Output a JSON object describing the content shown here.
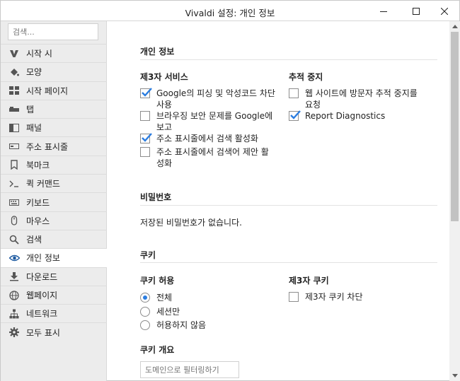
{
  "window": {
    "title": "Vivaldi 설정: 개인 정보"
  },
  "sidebar": {
    "search_placeholder": "검색...",
    "items": [
      {
        "label": "시작 시",
        "icon": "vivaldi-logo-icon"
      },
      {
        "label": "모양",
        "icon": "paint-bucket-icon"
      },
      {
        "label": "시작 페이지",
        "icon": "speed-dial-grid-icon"
      },
      {
        "label": "탭",
        "icon": "tabs-icon"
      },
      {
        "label": "패널",
        "icon": "panel-icon"
      },
      {
        "label": "주소 표시줄",
        "icon": "address-bar-icon"
      },
      {
        "label": "북마크",
        "icon": "bookmark-icon"
      },
      {
        "label": "퀵 커맨드",
        "icon": "quick-command-icon"
      },
      {
        "label": "키보드",
        "icon": "keyboard-icon"
      },
      {
        "label": "마우스",
        "icon": "mouse-icon"
      },
      {
        "label": "검색",
        "icon": "search-icon"
      },
      {
        "label": "개인 정보",
        "icon": "eye-icon",
        "active": true
      },
      {
        "label": "다운로드",
        "icon": "download-icon"
      },
      {
        "label": "웹페이지",
        "icon": "globe-icon"
      },
      {
        "label": "네트워크",
        "icon": "network-icon"
      },
      {
        "label": "모두 표시",
        "icon": "gear-icon"
      }
    ]
  },
  "privacy": {
    "section_title": "개인 정보",
    "third_party": {
      "title": "제3자 서비스",
      "options": [
        {
          "label_line1": "Google의 피싱 및 악성코드 차단",
          "label_line2": "사용",
          "checked": true
        },
        {
          "label_line1": "브라우징 보안 문제를 Google에",
          "label_line2": "보고",
          "checked": false
        },
        {
          "label_line1": "주소 표시줄에서 검색 활성화",
          "label_line2": "",
          "checked": true
        },
        {
          "label_line1": "주소 표시줄에서 검색어 제안 활",
          "label_line2": "성화",
          "checked": false
        }
      ]
    },
    "tracking": {
      "title": "추적 중지",
      "options": [
        {
          "label_line1": "웹 사이트에 방문자 추적 중지를",
          "label_line2": "요청",
          "checked": false
        },
        {
          "label_line1": "Report Diagnostics",
          "label_line2": "",
          "checked": true
        }
      ]
    }
  },
  "passwords": {
    "section_title": "비밀번호",
    "empty_text": "저장된 비밀번호가 없습니다."
  },
  "cookies": {
    "section_title": "쿠키",
    "allow": {
      "title": "쿠키 허용",
      "options": [
        {
          "label": "전체",
          "selected": true
        },
        {
          "label": "세션만",
          "selected": false
        },
        {
          "label": "허용하지 않음",
          "selected": false
        }
      ]
    },
    "third_party": {
      "title": "제3자 쿠키",
      "block_label": "제3자 쿠키 차단",
      "checked": false
    },
    "overview": {
      "title": "쿠키 개요",
      "filter_placeholder": "도메인으로 필터링하기"
    }
  },
  "colors": {
    "accent": "#2b7de0",
    "sidebar_bg": "#ececec",
    "icon": "#555555"
  }
}
